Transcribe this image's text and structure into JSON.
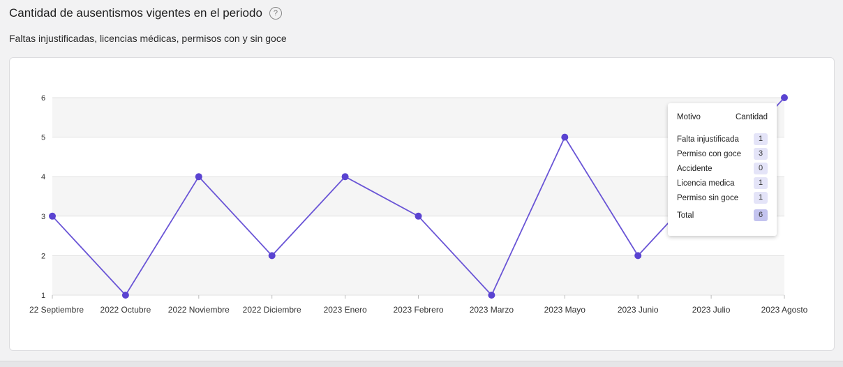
{
  "header": {
    "title": "Cantidad de ausentismos vigentes en el periodo",
    "help_icon": "?",
    "subtitle": "Faltas injustificadas, licencias médicas, permisos con y sin goce"
  },
  "colors": {
    "line": "#6a55d6",
    "point": "#5a43d1",
    "band": "#f5f5f5",
    "grid": "#e2e2e2"
  },
  "chart_data": {
    "type": "line",
    "x": [
      "22 Septiembre",
      "2022 Octubre",
      "2022 Noviembre",
      "2022 Diciembre",
      "2023 Enero",
      "2023 Febrero",
      "2023 Marzo",
      "2023 Mayo",
      "2023 Junio",
      "2023 Julio",
      "2023 Agosto"
    ],
    "series": [
      {
        "values": [
          3,
          1,
          4,
          2,
          4,
          3,
          1,
          5,
          2,
          4,
          6
        ]
      }
    ],
    "ylim": [
      1,
      6
    ],
    "yticks": [
      "1",
      "2",
      "3",
      "4",
      "5",
      "6"
    ],
    "grid": true,
    "legend": "none"
  },
  "tooltip": {
    "col_motivo": "Motivo",
    "col_cantidad": "Cantidad",
    "rows": [
      {
        "label": "Falta injustificada",
        "value": "1"
      },
      {
        "label": "Permiso con goce",
        "value": "3"
      },
      {
        "label": "Accidente",
        "value": "0"
      },
      {
        "label": "Licencia medica",
        "value": "1"
      },
      {
        "label": "Permiso sin goce",
        "value": "1"
      }
    ],
    "total_label": "Total",
    "total_value": "6"
  }
}
